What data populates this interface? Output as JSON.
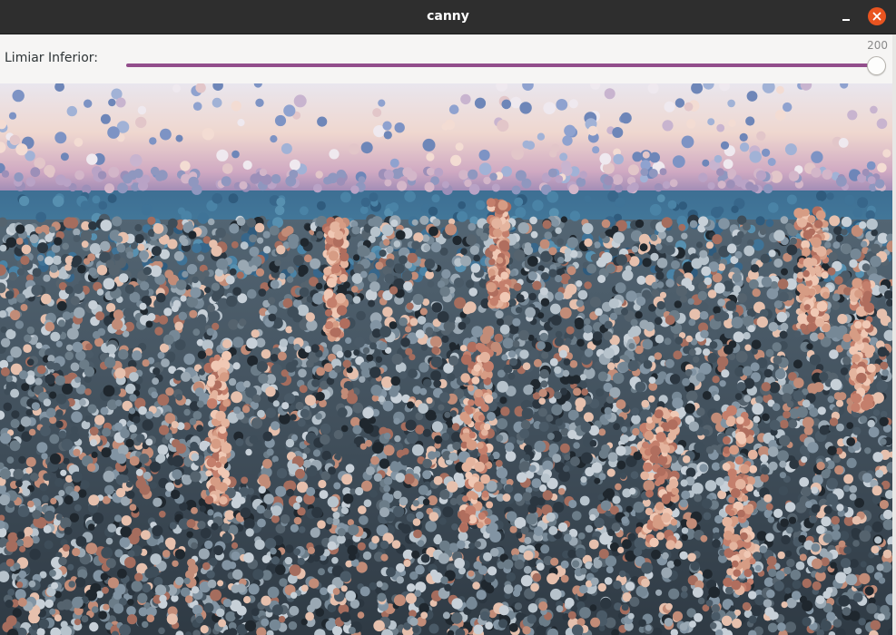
{
  "window": {
    "title": "canny",
    "minimize_icon": "minimize-icon",
    "close_icon": "close-icon",
    "close_color": "#e95420"
  },
  "trackbar": {
    "label": "Limiar Inferior:",
    "value": "200",
    "level": 1.0,
    "track_color": "#924d8b"
  },
  "image": {
    "description_icon": "processed-image"
  }
}
